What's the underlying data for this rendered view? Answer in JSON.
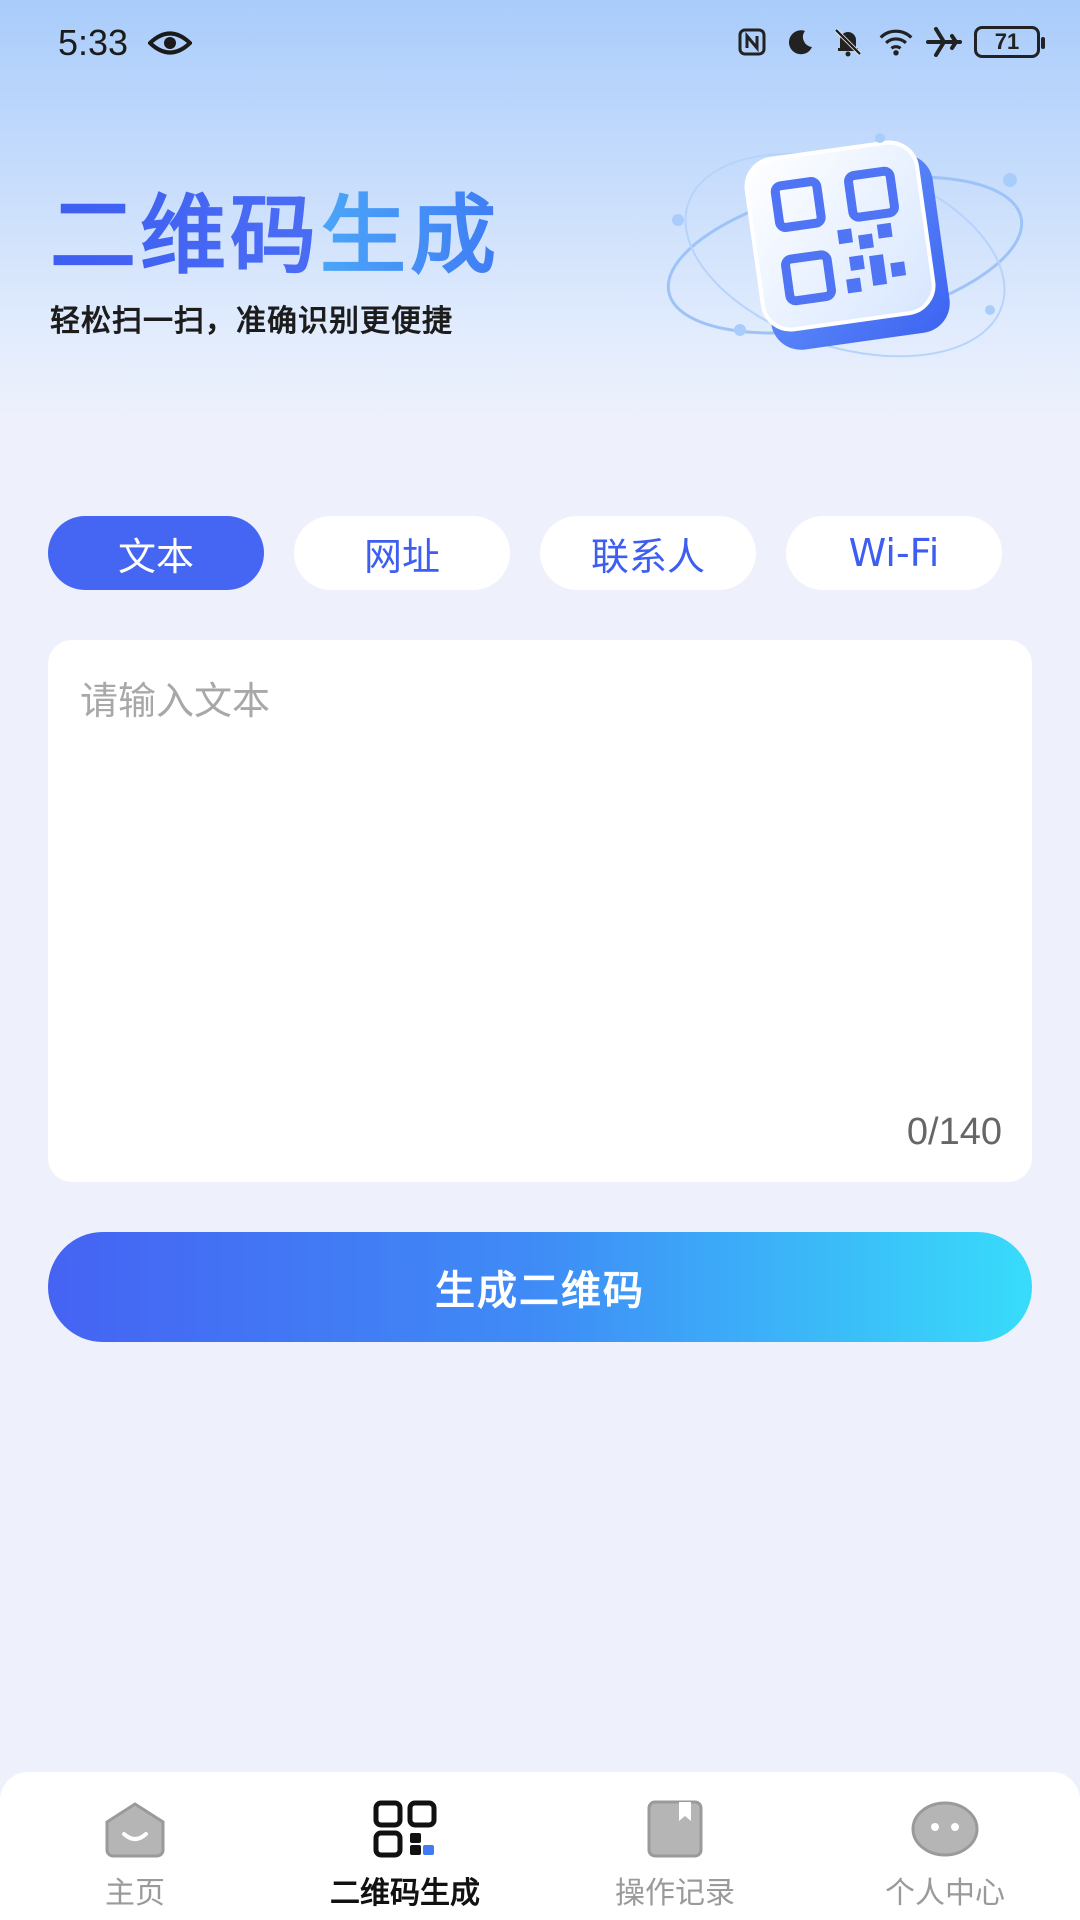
{
  "status_bar": {
    "time": "5:33",
    "battery": "71",
    "icons": [
      "eye-icon",
      "nfc-icon",
      "moon-icon",
      "bell-off-icon",
      "wifi-icon",
      "airplane-icon",
      "battery-icon"
    ]
  },
  "header": {
    "title_part1": "二维码",
    "title_part2": "生成",
    "subtitle": "轻松扫一扫，准确识别更便捷",
    "illustration": "qr-code-illustration"
  },
  "tabs": [
    {
      "label": "文本",
      "active": true
    },
    {
      "label": "网址",
      "active": false
    },
    {
      "label": "联系人",
      "active": false
    },
    {
      "label": "Wi-Fi",
      "active": false
    }
  ],
  "text_input": {
    "placeholder": "请输入文本",
    "value": "",
    "counter": "0/140"
  },
  "generate_button": {
    "label": "生成二维码"
  },
  "bottom_nav": [
    {
      "label": "主页",
      "icon": "home-icon",
      "active": false
    },
    {
      "label": "二维码生成",
      "icon": "qr-code-icon",
      "active": true
    },
    {
      "label": "操作记录",
      "icon": "record-icon",
      "active": false
    },
    {
      "label": "个人中心",
      "icon": "profile-icon",
      "active": false
    }
  ],
  "colors": {
    "accent": "#4466f2",
    "background": "#eef1fc",
    "gradient_start": "#4563f3",
    "gradient_end": "#38dcfa",
    "inactive_nav": "#9a9a9a"
  }
}
